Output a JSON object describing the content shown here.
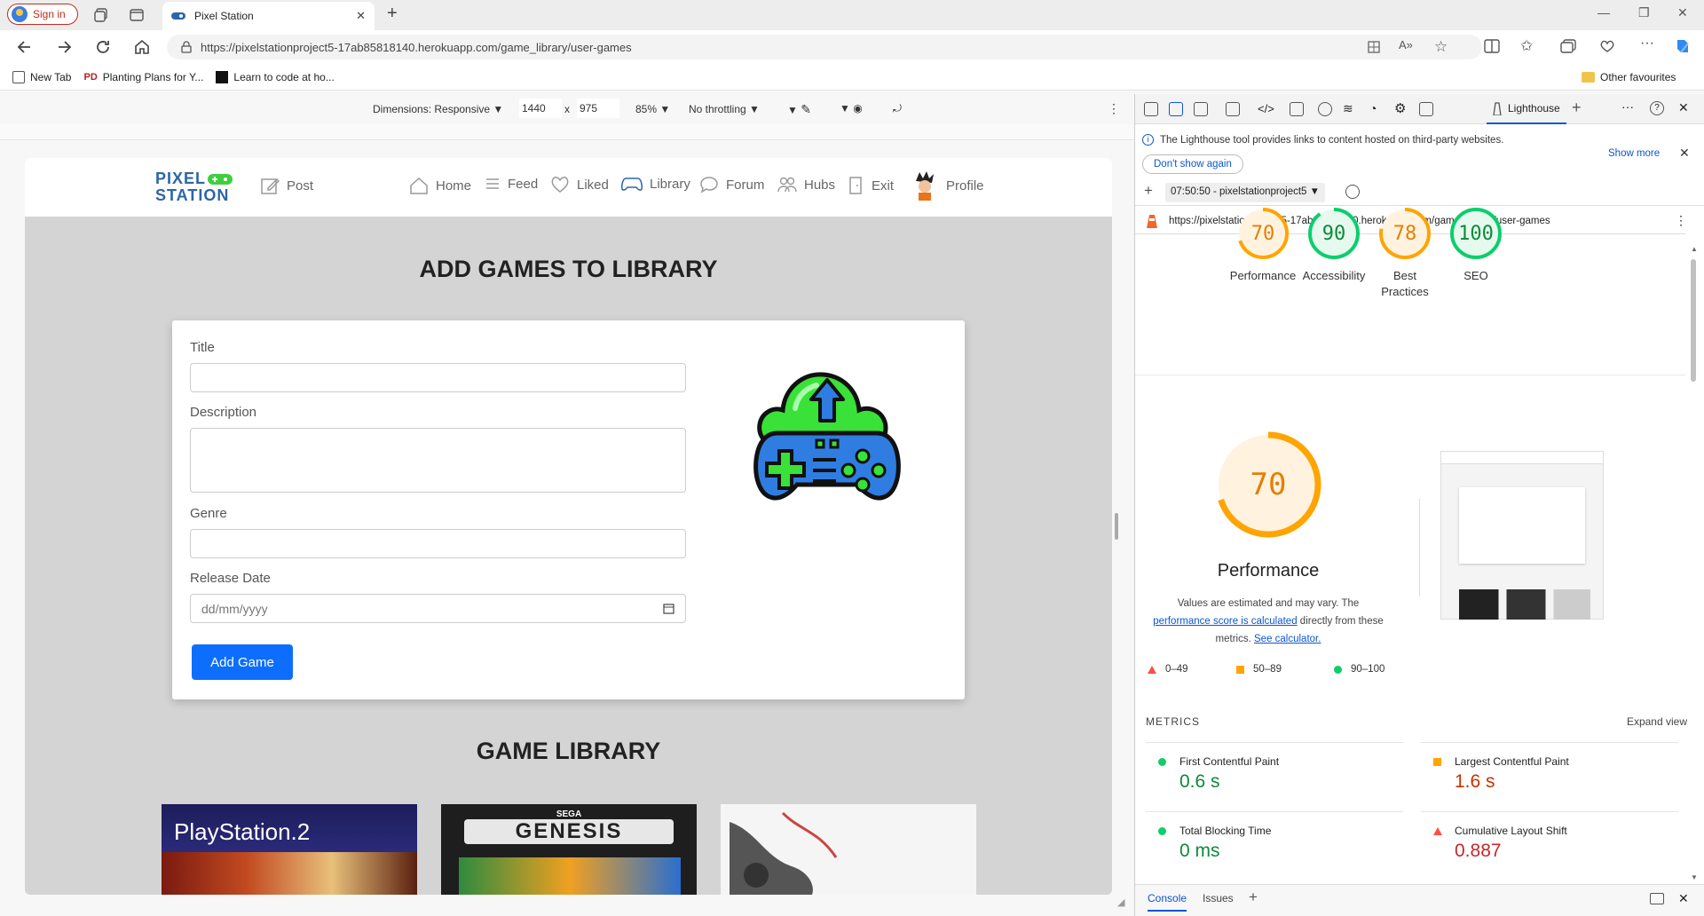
{
  "browser": {
    "signin_label": "Sign in",
    "tab_title": "Pixel Station",
    "url": "https://pixelstationproject5-17ab85818140.herokuapp.com/game_library/user-games",
    "bookmarks": [
      "New Tab",
      "Planting Plans for Y...",
      "Learn to code at ho..."
    ],
    "other_favourites": "Other favourites"
  },
  "device_toolbar": {
    "dimensions": "Dimensions: Responsive",
    "width": "1440",
    "x": "x",
    "height": "975",
    "zoom": "85%",
    "throttling": "No throttling"
  },
  "site": {
    "logo_line1": "PIXEL",
    "logo_line2": "STATION",
    "nav": {
      "post": "Post",
      "home": "Home",
      "feed": "Feed",
      "liked": "Liked",
      "library": "Library",
      "forum": "Forum",
      "hubs": "Hubs",
      "exit": "Exit",
      "profile": "Profile"
    },
    "heading": "ADD GAMES TO LIBRARY",
    "form": {
      "title_label": "Title",
      "description_label": "Description",
      "genre_label": "Genre",
      "release_label": "Release Date",
      "release_placeholder": "dd/mm/yyyy",
      "submit": "Add Game"
    },
    "library_heading": "GAME LIBRARY",
    "games": [
      "PlayStation.2",
      "GENESIS",
      ""
    ],
    "game_sublabels": [
      "",
      "SEGA",
      ""
    ]
  },
  "devtools": {
    "lighthouse_tab": "Lighthouse",
    "notice": "The Lighthouse tool provides links to content hosted on third-party websites.",
    "show_more": "Show more",
    "dont_show": "Don't show again",
    "session": "07:50:50 - pixelstationproject5",
    "report_url": "https://pixelstationproject5-17ab85818140.herokuapp.com/game_library/user-games",
    "scores": [
      {
        "label": "Performance",
        "value": 70,
        "color": "#e67e00"
      },
      {
        "label": "Accessibility",
        "value": 90,
        "color": "#0c8a3a"
      },
      {
        "label": "Best Practices",
        "value": 78,
        "color": "#e67e00"
      },
      {
        "label": "SEO",
        "value": 100,
        "color": "#0c8a3a"
      }
    ],
    "perf_big_value": "70",
    "perf_title": "Performance",
    "perf_desc_1": "Values are estimated and may vary. The",
    "perf_link_1": "performance score is calculated",
    "perf_desc_2": "directly from these",
    "perf_desc_3": "metrics.",
    "perf_link_2": "See calculator.",
    "legend": [
      "0–49",
      "50–89",
      "90–100"
    ],
    "metrics_header": "METRICS",
    "expand_view": "Expand view",
    "metrics": [
      {
        "name": "First Contentful Paint",
        "value": "0.6 s",
        "status": "pass"
      },
      {
        "name": "Largest Contentful Paint",
        "value": "1.6 s",
        "status": "average"
      },
      {
        "name": "Total Blocking Time",
        "value": "0 ms",
        "status": "pass"
      },
      {
        "name": "Cumulative Layout Shift",
        "value": "0.887",
        "status": "fail"
      }
    ],
    "drawer_tabs": [
      "Console",
      "Issues"
    ]
  },
  "colors": {
    "pass": "#0cce6b",
    "average": "#ffa400",
    "fail": "#ff4e42",
    "accent": "#0d6efd"
  }
}
